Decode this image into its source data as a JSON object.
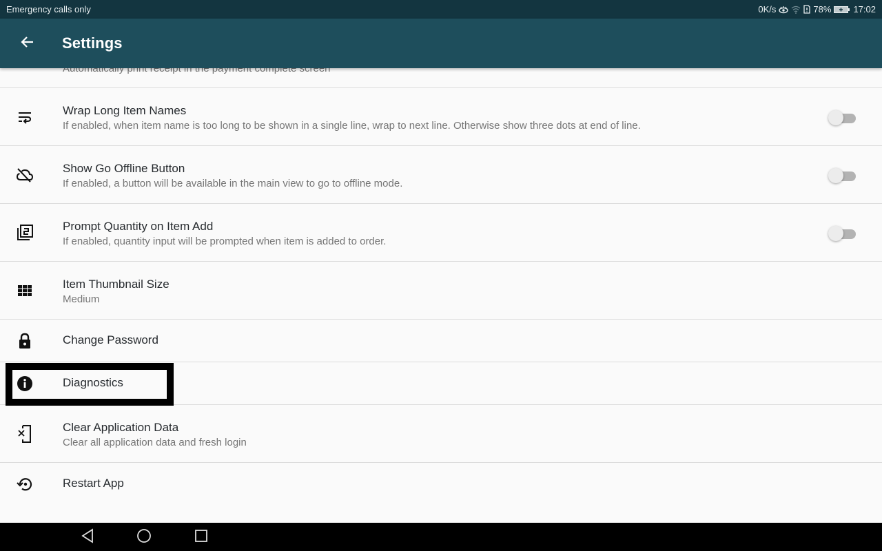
{
  "status_bar": {
    "carrier_text": "Emergency calls only",
    "network_speed": "0K/s",
    "battery_percent": "78%",
    "time": "17:02",
    "icons": [
      "eye-comfort-icon",
      "wifi-icon",
      "sim-icon",
      "battery-charging-icon"
    ]
  },
  "app_bar": {
    "title": "Settings",
    "back_icon": "arrow-left-icon"
  },
  "colors": {
    "status_bar": "#133540",
    "app_bar": "#1e4e5c",
    "background": "#fafafa",
    "switch_off_track": "#b3b3b3",
    "switch_off_thumb": "#ececec"
  },
  "settings": {
    "partial_top_subtitle": "Automatically print receipt in the payment complete screen",
    "items": [
      {
        "icon": "wrap-text-icon",
        "title": "Wrap Long Item Names",
        "subtitle": "If enabled, when item name is too long to be shown in a single line, wrap to next line. Otherwise show three dots at end of line.",
        "toggle": false
      },
      {
        "icon": "cloud-off-icon",
        "title": "Show Go Offline Button",
        "subtitle": "If enabled, a button will be available in the main view to go to offline mode.",
        "toggle": false
      },
      {
        "icon": "filter-2-icon",
        "title": "Prompt Quantity on Item Add",
        "subtitle": "If enabled, quantity input will be prompted when item is added to order.",
        "toggle": false
      },
      {
        "icon": "grid-icon",
        "title": "Item Thumbnail Size",
        "subtitle": "Medium"
      },
      {
        "icon": "lock-icon",
        "title": "Change Password"
      },
      {
        "icon": "info-icon",
        "title": "Diagnostics",
        "highlighted": true
      },
      {
        "icon": "phone-clear-icon",
        "title": "Clear Application Data",
        "subtitle": "Clear all application data and fresh login"
      },
      {
        "icon": "restart-icon",
        "title": "Restart App"
      }
    ]
  },
  "nav_bar": {
    "buttons": [
      "back-triangle-icon",
      "home-circle-icon",
      "recents-square-icon"
    ]
  }
}
